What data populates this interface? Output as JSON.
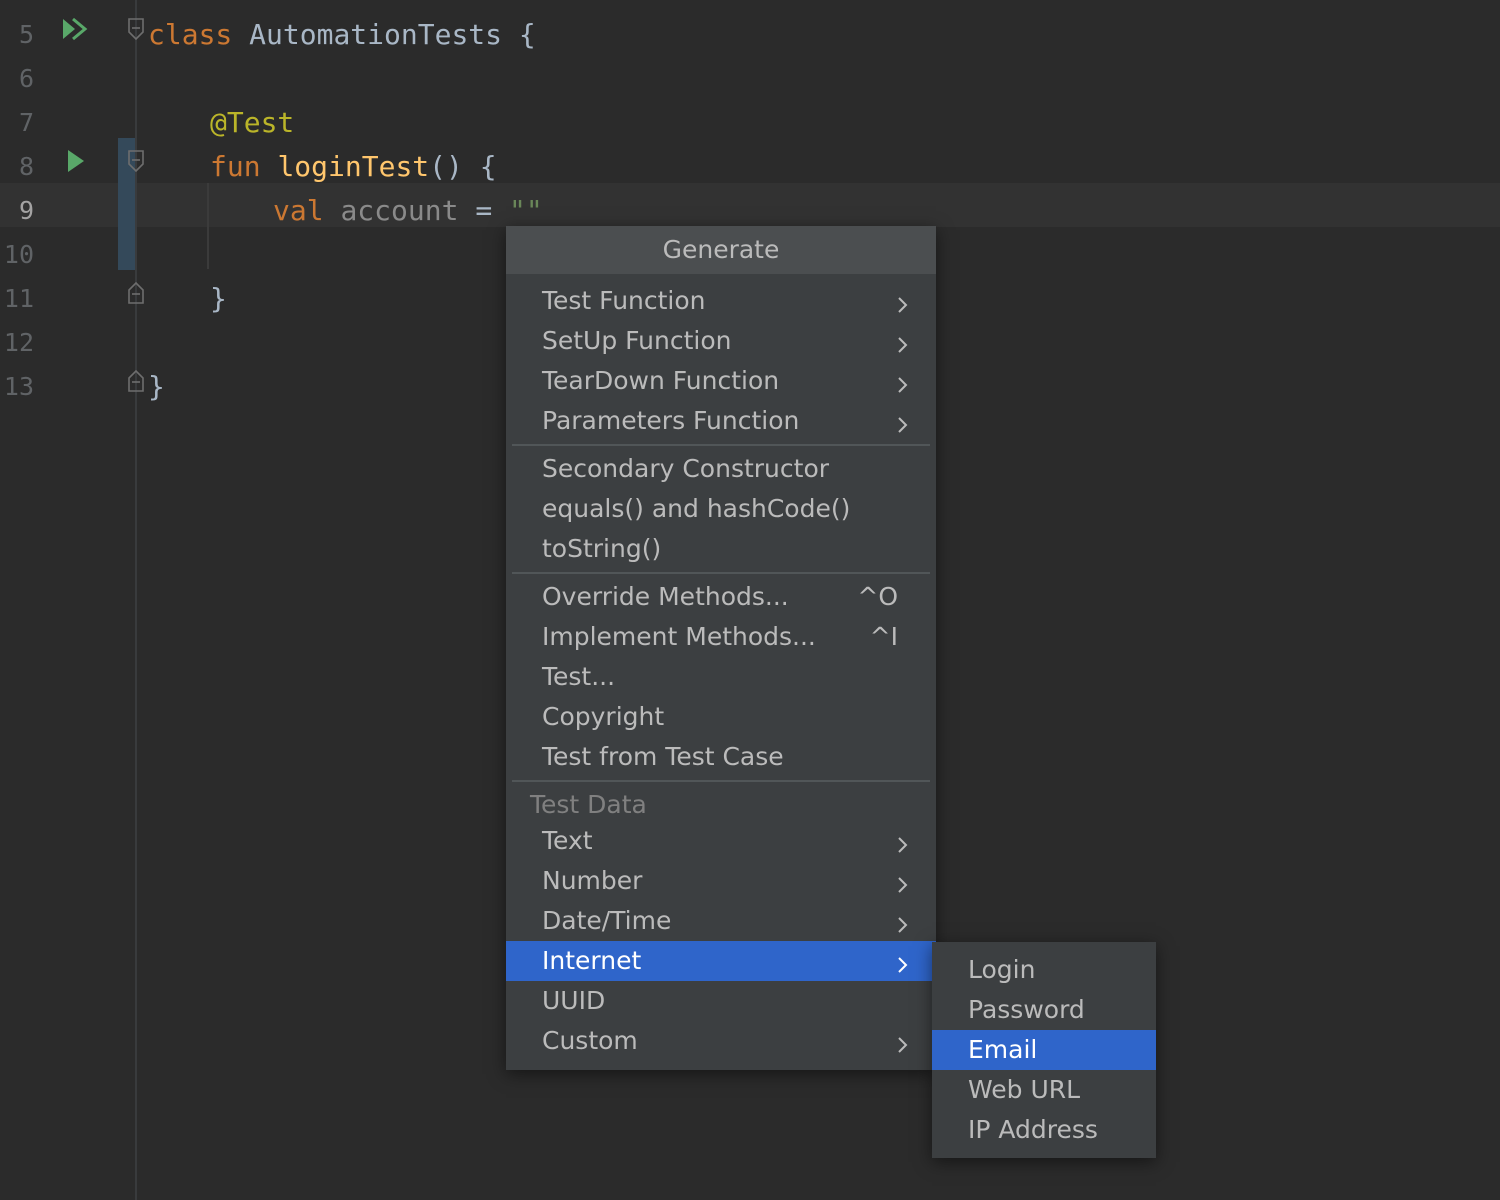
{
  "editor": {
    "lines": [
      {
        "number": "5"
      },
      {
        "number": "6"
      },
      {
        "number": "7"
      },
      {
        "number": "8"
      },
      {
        "number": "9"
      },
      {
        "number": "10"
      },
      {
        "number": "11"
      },
      {
        "number": "12"
      },
      {
        "number": "13"
      }
    ],
    "code": {
      "class_kw": "class",
      "class_name": "AutomationTests",
      "open_brace": "{",
      "annotation": "@Test",
      "fun_kw": "fun",
      "fun_name": "loginTest",
      "fun_parens": "() {",
      "val_kw": "val",
      "var_name": "account",
      "equals": "=",
      "string_value": "\"\"",
      "close_brace_inner": "}",
      "close_brace_outer": "}"
    }
  },
  "popup": {
    "title": "Generate",
    "group1": [
      {
        "label": "Test Function",
        "submenu": true
      },
      {
        "label": "SetUp Function",
        "submenu": true
      },
      {
        "label": "TearDown Function",
        "submenu": true
      },
      {
        "label": "Parameters Function",
        "submenu": true
      }
    ],
    "group2": [
      {
        "label": "Secondary Constructor"
      },
      {
        "label": "equals() and hashCode()"
      },
      {
        "label": "toString()"
      }
    ],
    "group3": [
      {
        "label": "Override Methods...",
        "shortcut": "^O"
      },
      {
        "label": "Implement Methods...",
        "shortcut": "^I"
      },
      {
        "label": "Test..."
      },
      {
        "label": "Copyright"
      },
      {
        "label": "Test from Test Case"
      }
    ],
    "test_data_label": "Test Data",
    "group4": [
      {
        "label": "Text",
        "submenu": true
      },
      {
        "label": "Number",
        "submenu": true
      },
      {
        "label": "Date/Time",
        "submenu": true
      },
      {
        "label": "Internet",
        "submenu": true,
        "selected": true
      },
      {
        "label": "UUID"
      },
      {
        "label": "Custom",
        "submenu": true
      }
    ]
  },
  "submenu": {
    "items": [
      {
        "label": "Login"
      },
      {
        "label": "Password"
      },
      {
        "label": "Email",
        "selected": true
      },
      {
        "label": "Web URL"
      },
      {
        "label": "IP Address"
      }
    ]
  },
  "colors": {
    "background": "#2b2b2b",
    "popup_bg": "#3c3f41",
    "selection": "#2f65ca",
    "keyword": "#cc7832",
    "annotation": "#bbb529",
    "function_name": "#ffc66d",
    "string": "#6a8759"
  }
}
